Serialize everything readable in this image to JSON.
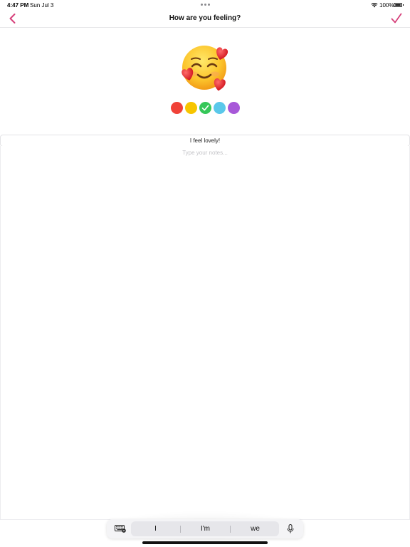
{
  "status_bar": {
    "time": "4:47 PM",
    "date": "Sun Jul 3",
    "battery": "100%"
  },
  "nav": {
    "title": "How are you feeling?",
    "back_icon": "chevron-left-icon",
    "done_icon": "checkmark-icon",
    "accent_color": "#d6407a"
  },
  "mood": {
    "emoji_icon": "smiling-face-with-hearts-icon",
    "colors": [
      "#f04238",
      "#f7c500",
      "#36c759",
      "#5ac8ea",
      "#a758d8"
    ],
    "selected_index": 2
  },
  "entry": {
    "title_value": "I feel lovely!",
    "notes_placeholder": "Type your notes..."
  },
  "keyboard_bar": {
    "predictions": [
      "I",
      "I'm",
      "we"
    ]
  }
}
